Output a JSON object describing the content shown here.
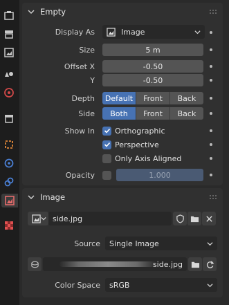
{
  "tabs": [
    {
      "name": "tool-tab",
      "icon": "tool-icon"
    },
    {
      "name": "render-tab",
      "icon": "render-icon"
    },
    {
      "name": "output-tab",
      "icon": "output-icon"
    },
    {
      "name": "view-layer-tab",
      "icon": "view-layer-icon"
    },
    {
      "name": "scene-tab",
      "icon": "scene-icon"
    },
    {
      "name": "world-tab",
      "icon": "world-icon"
    },
    {
      "name": "collection-tab",
      "icon": "collection-icon"
    },
    {
      "name": "object-tab",
      "icon": "object-icon"
    },
    {
      "name": "physics-tab",
      "icon": "physics-icon"
    },
    {
      "name": "constraints-tab",
      "icon": "constraints-icon"
    },
    {
      "name": "object-data-tab",
      "icon": "image-data-icon",
      "active": true
    },
    {
      "name": "texture-tab",
      "icon": "texture-icon"
    }
  ],
  "empty_panel": {
    "title": "Empty",
    "display_as": {
      "label": "Display As",
      "value": "Image"
    },
    "size": {
      "label": "Size",
      "value": "5 m"
    },
    "offset_x": {
      "label": "Offset X",
      "value": "-0.50"
    },
    "offset_y": {
      "label": "Y",
      "value": "-0.50"
    },
    "depth": {
      "label": "Depth",
      "options": [
        "Default",
        "Front",
        "Back"
      ],
      "selected": "Default"
    },
    "side": {
      "label": "Side",
      "options": [
        "Both",
        "Front",
        "Back"
      ],
      "selected": "Both"
    },
    "show_in": {
      "label": "Show In",
      "orthographic": {
        "label": "Orthographic",
        "checked": true
      },
      "perspective": {
        "label": "Perspective",
        "checked": true
      },
      "only_axis_aligned": {
        "label": "Only Axis Aligned",
        "checked": false
      }
    },
    "opacity": {
      "label": "Opacity",
      "value": "1.000",
      "enabled": false
    }
  },
  "image_panel": {
    "title": "Image",
    "image_name": "side.jpg",
    "source": {
      "label": "Source",
      "value": "Single Image"
    },
    "filepath": {
      "value": "side.jpg"
    },
    "color_space": {
      "label": "Color Space",
      "value": "sRGB"
    }
  },
  "colors": {
    "accent": "#4772b3",
    "panel": "#303030",
    "field": "#545454"
  }
}
